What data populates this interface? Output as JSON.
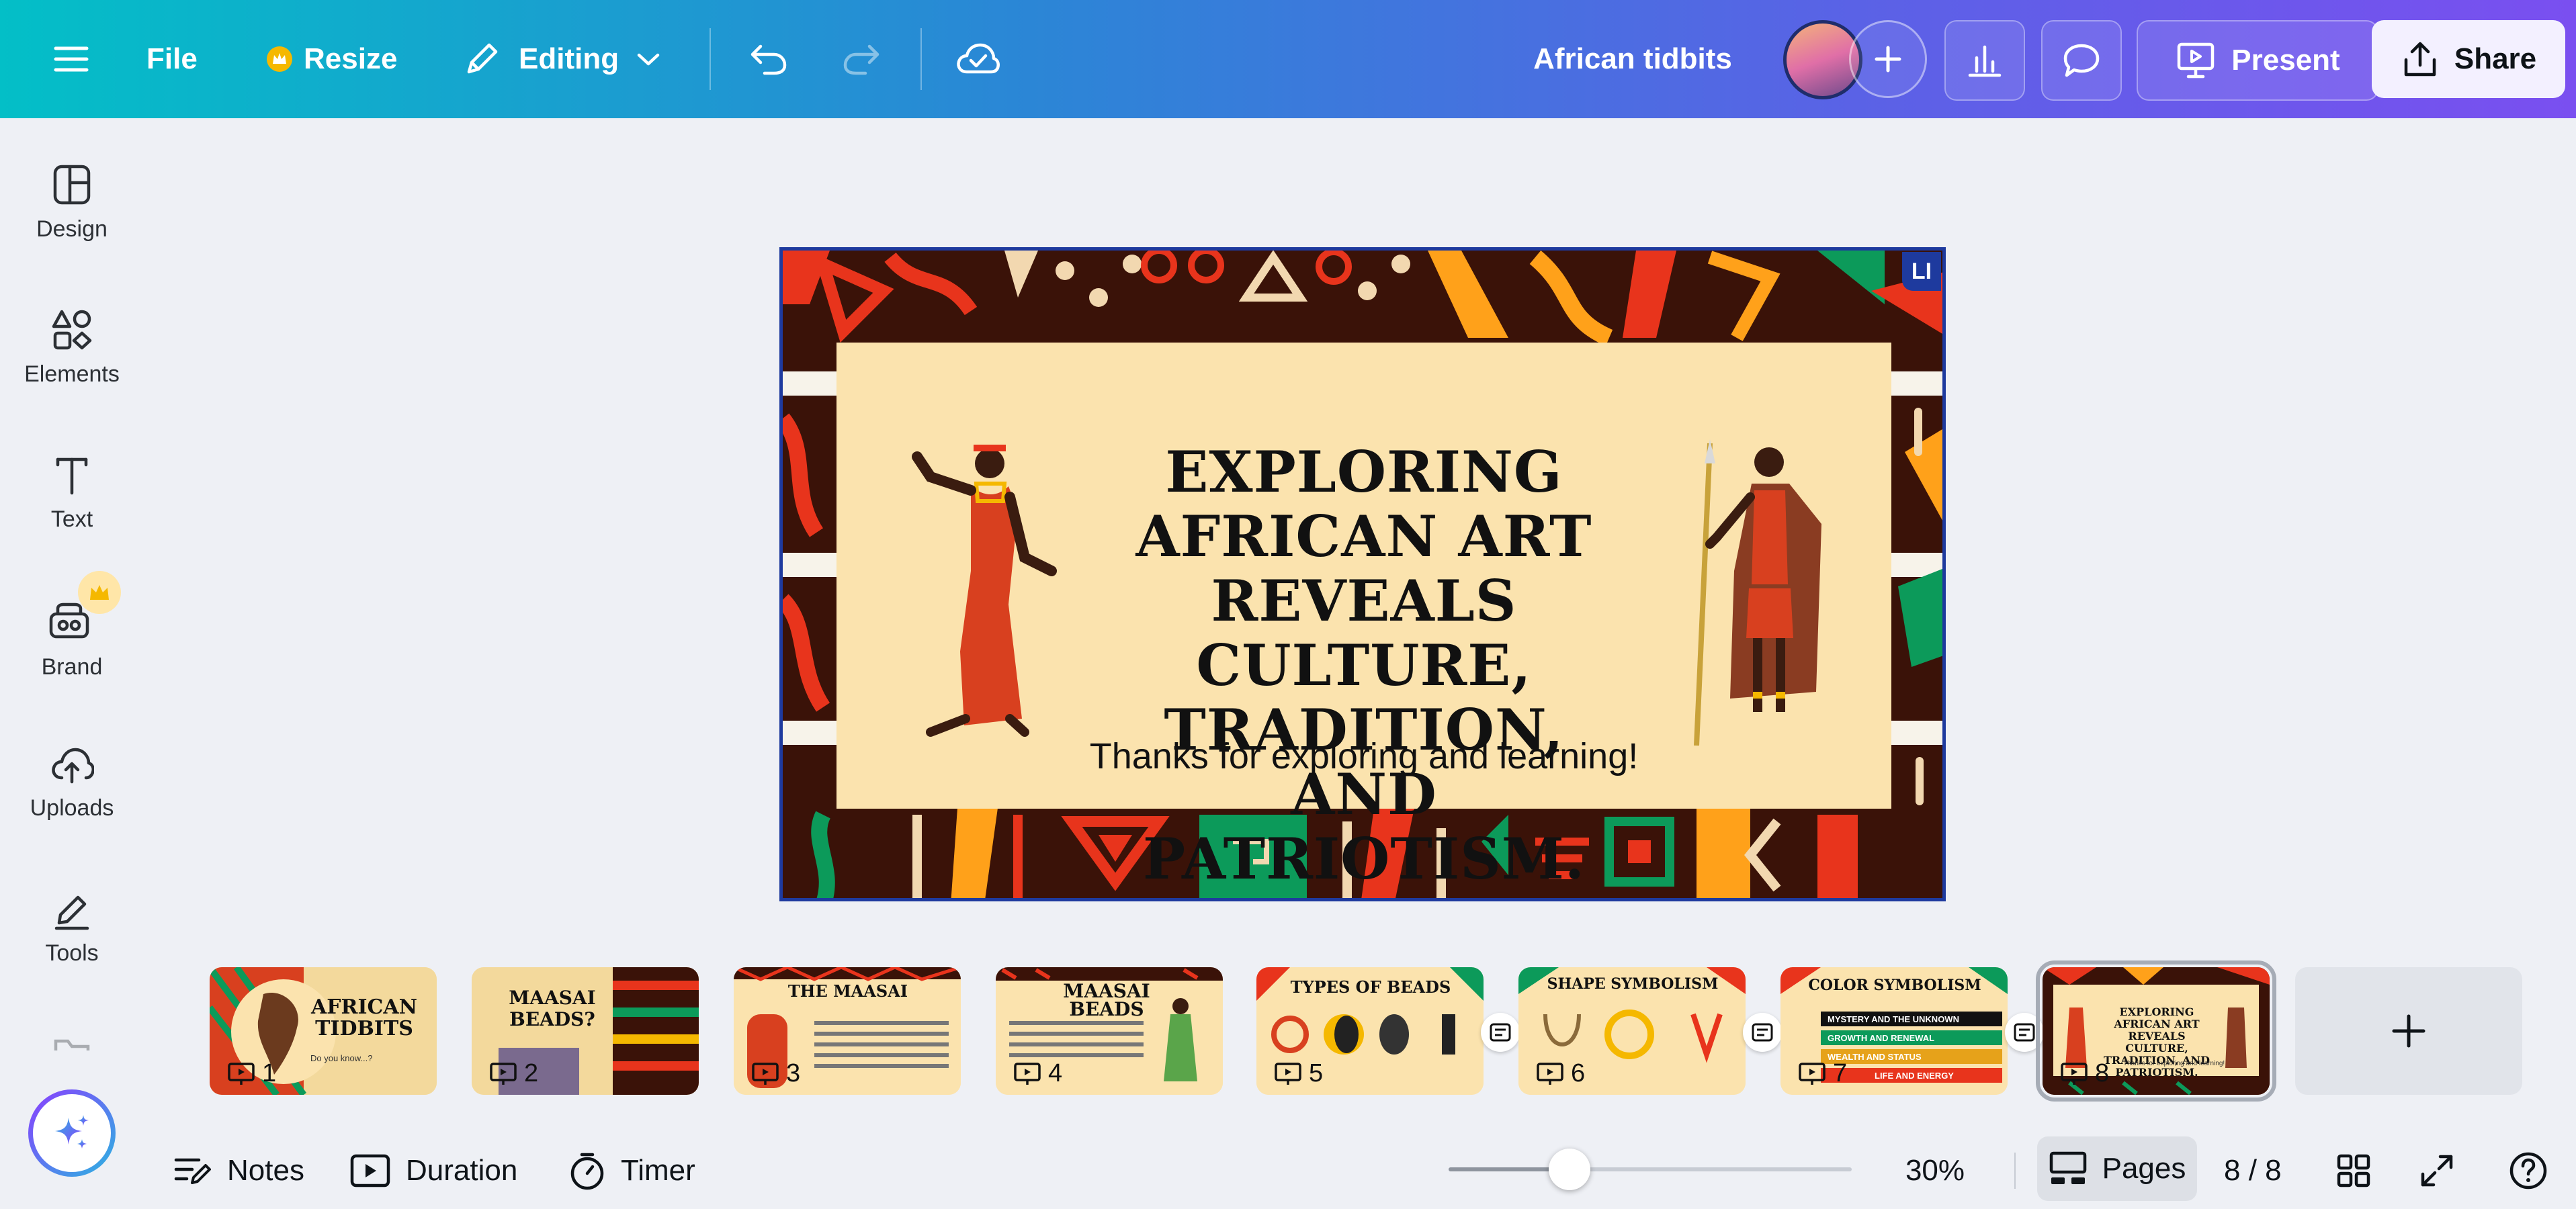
{
  "colors": {
    "topbar_gradient_start": "#03bfc7",
    "topbar_gradient_end": "#7a4ff0",
    "canvas_bg": "#eef0f5",
    "slide_border": "#1e3a9e",
    "card_bg": "#fbe3ae",
    "crown": "#f5b800"
  },
  "topbar": {
    "menu_icon": "hamburger-icon",
    "file_label": "File",
    "resize_label": "Resize",
    "editing_label": "Editing",
    "doc_title": "African tidbits",
    "present_label": "Present",
    "share_label": "Share"
  },
  "sidebar": {
    "items": [
      {
        "label": "Design",
        "icon": "design-icon"
      },
      {
        "label": "Elements",
        "icon": "elements-icon"
      },
      {
        "label": "Text",
        "icon": "text-icon"
      },
      {
        "label": "Brand",
        "icon": "brand-icon"
      },
      {
        "label": "Uploads",
        "icon": "uploads-icon"
      },
      {
        "label": "Tools",
        "icon": "tools-icon"
      }
    ]
  },
  "slide": {
    "title": "Exploring African art reveals culture, tradition, and patriotism.",
    "subtitle": "Thanks for exploring and learning!",
    "collaborator_tag": "LI"
  },
  "thumbnails": [
    {
      "number": "1",
      "title": "African Tidbits",
      "caption": "Do you know...?"
    },
    {
      "number": "2",
      "title": "Maasai Beads?"
    },
    {
      "number": "3",
      "title": "The Maasai"
    },
    {
      "number": "4",
      "title": "Maasai Beads"
    },
    {
      "number": "5",
      "title": "Types of Beads"
    },
    {
      "number": "6",
      "title": "Shape Symbolism"
    },
    {
      "number": "7",
      "title": "Color Symbolism",
      "bands": [
        "Mystery and the Unknown",
        "Growth and Renewal",
        "Wealth and Status",
        "Life and Energy"
      ]
    },
    {
      "number": "8",
      "title": "Exploring African Art Reveals Culture, Tradition, and Patriotism.",
      "active": true
    }
  ],
  "bottombar": {
    "notes_label": "Notes",
    "duration_label": "Duration",
    "timer_label": "Timer",
    "zoom_percent": "30%",
    "zoom_fraction": 0.3,
    "pages_label": "Pages",
    "page_counter": "8 / 8"
  }
}
